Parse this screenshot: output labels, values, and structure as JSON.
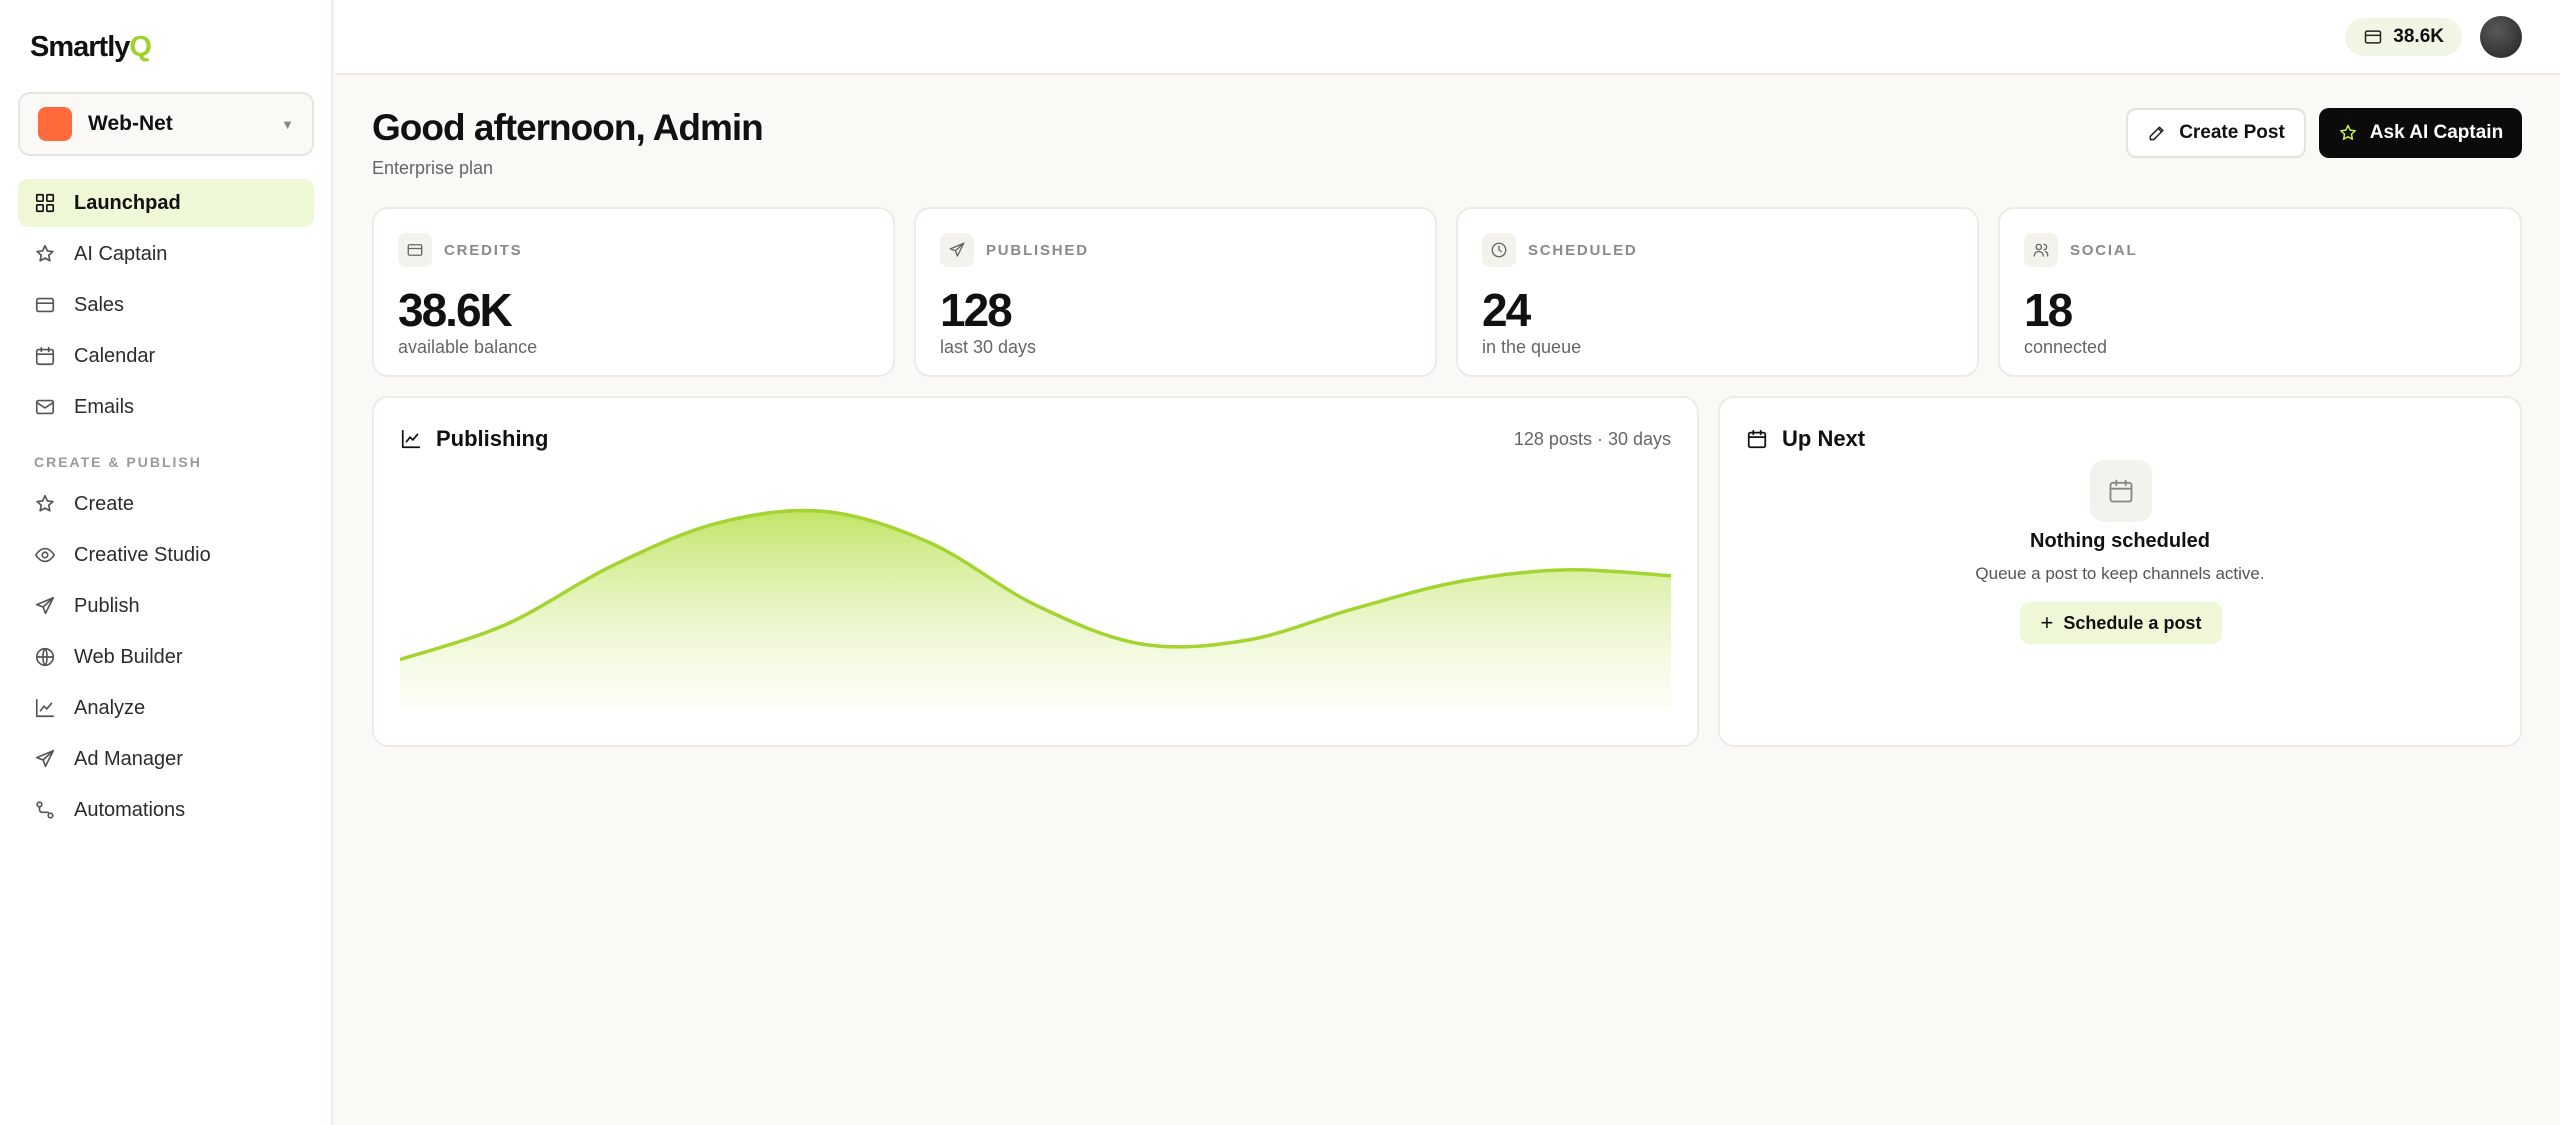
{
  "brand": {
    "name_main": "Smartly",
    "name_accent": "Q",
    "accent_color": "#9fd22a"
  },
  "workspace": {
    "name": "Web-Net",
    "color": "#ff6b3d"
  },
  "nav": {
    "main": [
      {
        "label": "Launchpad",
        "icon": "grid-icon",
        "active": true
      },
      {
        "label": "AI Captain",
        "icon": "star-icon"
      },
      {
        "label": "Sales",
        "icon": "card-icon"
      },
      {
        "label": "Calendar",
        "icon": "calendar-icon"
      },
      {
        "label": "Emails",
        "icon": "mail-icon"
      }
    ],
    "section_label": "CREATE & PUBLISH",
    "create": [
      {
        "label": "Create",
        "icon": "star-icon"
      },
      {
        "label": "Creative Studio",
        "icon": "eye-icon"
      },
      {
        "label": "Publish",
        "icon": "send-icon"
      },
      {
        "label": "Web Builder",
        "icon": "globe-icon"
      },
      {
        "label": "Analyze",
        "icon": "chart-icon"
      },
      {
        "label": "Ad Manager",
        "icon": "send-icon"
      },
      {
        "label": "Automations",
        "icon": "flow-icon"
      }
    ]
  },
  "topbar": {
    "credits": "38.6K"
  },
  "header": {
    "greeting": "Good afternoon, Admin",
    "plan": "Enterprise plan",
    "create_post": "Create Post",
    "ask_ai": "Ask AI Captain"
  },
  "stats": [
    {
      "label": "CREDITS",
      "value": "38.6K",
      "sub": "available balance",
      "icon": "card-icon"
    },
    {
      "label": "PUBLISHED",
      "value": "128",
      "sub": "last 30 days",
      "icon": "send-icon"
    },
    {
      "label": "SCHEDULED",
      "value": "24",
      "sub": "in the queue",
      "icon": "clock-icon"
    },
    {
      "label": "SOCIAL",
      "value": "18",
      "sub": "connected",
      "icon": "users-icon"
    }
  ],
  "publishing": {
    "title": "Publishing",
    "meta": "128 posts · 30 days"
  },
  "chart_data": {
    "type": "area",
    "x": [
      0,
      1,
      2,
      3,
      4,
      5,
      6,
      7,
      8,
      9,
      10,
      11,
      12
    ],
    "values": [
      0.12,
      0.3,
      0.6,
      0.82,
      0.88,
      0.72,
      0.4,
      0.2,
      0.22,
      0.38,
      0.52,
      0.58,
      0.55
    ],
    "ylim": [
      0,
      1
    ],
    "grid": false,
    "color": "#a3d42f"
  },
  "up_next": {
    "title": "Up Next",
    "empty_title": "Nothing scheduled",
    "empty_sub": "Queue a post to keep channels active.",
    "button": "Schedule a post"
  }
}
